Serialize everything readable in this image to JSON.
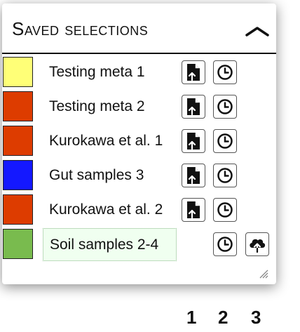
{
  "panel": {
    "title": "Saved selections",
    "collapse_icon": "chevron-up-icon"
  },
  "selections": [
    {
      "label": "Testing meta 1",
      "color": "#ffff77",
      "buttons": [
        "load-icon",
        "history-icon"
      ]
    },
    {
      "label": "Testing meta 2",
      "color": "#dd3c00",
      "buttons": [
        "load-icon",
        "history-icon"
      ]
    },
    {
      "label": "Kurokawa et al. 1",
      "color": "#dd3c00",
      "buttons": [
        "load-icon",
        "history-icon"
      ]
    },
    {
      "label": "Gut samples 3",
      "color": "#1418ff",
      "buttons": [
        "load-icon",
        "history-icon"
      ]
    },
    {
      "label": "Kurokawa et al. 2",
      "color": "#dd3c00",
      "buttons": [
        "load-icon",
        "history-icon"
      ]
    },
    {
      "label": "Soil samples 2-4",
      "color": "#79bb4e",
      "editing": true,
      "buttons": [
        "history-icon",
        "cloud-upload-icon"
      ]
    }
  ],
  "column_numbers": [
    "1",
    "2",
    "3"
  ]
}
